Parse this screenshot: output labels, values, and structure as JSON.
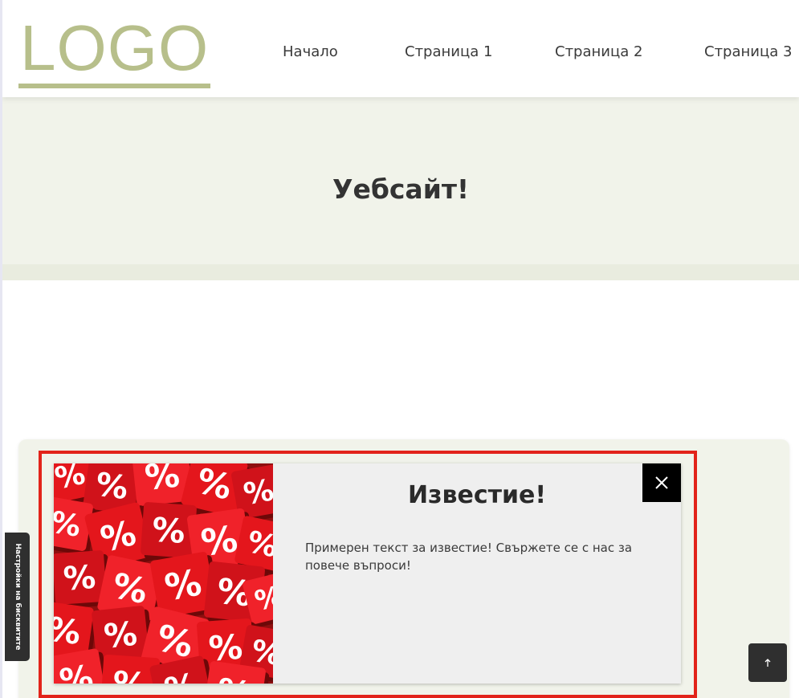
{
  "header": {
    "logo": "LOGO",
    "nav": [
      {
        "label": "Начало"
      },
      {
        "label": "Страница 1"
      },
      {
        "label": "Страница 2"
      },
      {
        "label": "Страница 3"
      }
    ]
  },
  "hero": {
    "title": "Уебсайт!"
  },
  "notification": {
    "title": "Известие!",
    "text": "Примерен текст за известие! Свържете се с нас за повече въпроси!",
    "image_icon": "percent-cubes-image",
    "close_icon": "close-icon"
  },
  "cookie_settings": {
    "label": "Настройки на бисквитите"
  },
  "back_to_top": {
    "icon": "arrow-up-icon"
  },
  "colors": {
    "logo": "#b7bf8b",
    "hero_bg": "#f1f3ea",
    "highlight": "#e2231a",
    "dark_button": "#2f2f2f"
  }
}
